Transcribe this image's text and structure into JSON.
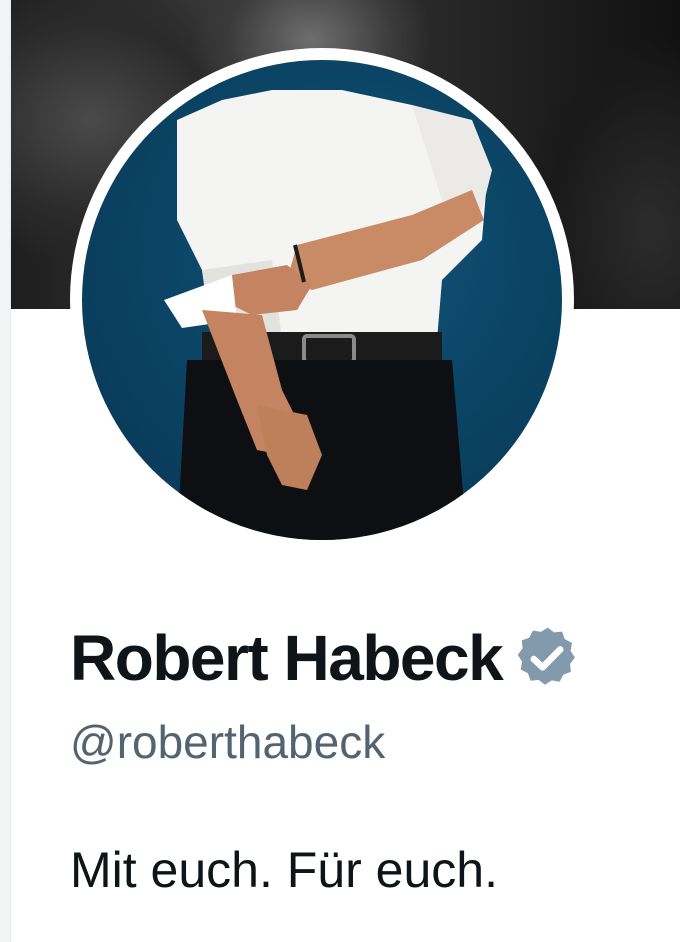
{
  "profile": {
    "display_name": "Robert Habeck",
    "handle": "@roberthabeck",
    "bio": "Mit euch. Für euch.",
    "verified_badge_icon": "verified-badge-icon",
    "verified_badge_color": "#829aab"
  },
  "colors": {
    "name_text": "#0f1419",
    "handle_text": "#536471",
    "avatar_background": "#0b4566"
  }
}
